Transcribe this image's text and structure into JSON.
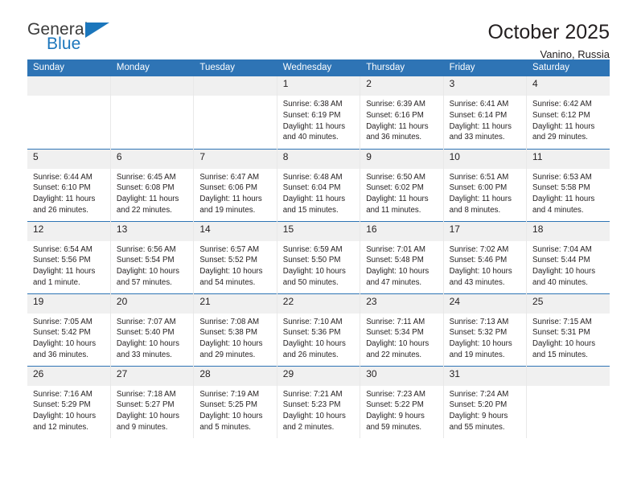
{
  "brand": {
    "name_top": "General",
    "name_bottom": "Blue",
    "accent_color": "#1b76bc"
  },
  "header": {
    "title": "October 2025",
    "location": "Vanino, Russia"
  },
  "theme": {
    "header_row_bg": "#2e74b5",
    "day_band_bg": "#f0f0f0",
    "text_color": "#231f20"
  },
  "weekday_headers": [
    "Sunday",
    "Monday",
    "Tuesday",
    "Wednesday",
    "Thursday",
    "Friday",
    "Saturday"
  ],
  "weeks": [
    [
      {
        "day": "",
        "lines": []
      },
      {
        "day": "",
        "lines": []
      },
      {
        "day": "",
        "lines": []
      },
      {
        "day": "1",
        "lines": [
          "Sunrise: 6:38 AM",
          "Sunset: 6:19 PM",
          "Daylight: 11 hours",
          "and 40 minutes."
        ]
      },
      {
        "day": "2",
        "lines": [
          "Sunrise: 6:39 AM",
          "Sunset: 6:16 PM",
          "Daylight: 11 hours",
          "and 36 minutes."
        ]
      },
      {
        "day": "3",
        "lines": [
          "Sunrise: 6:41 AM",
          "Sunset: 6:14 PM",
          "Daylight: 11 hours",
          "and 33 minutes."
        ]
      },
      {
        "day": "4",
        "lines": [
          "Sunrise: 6:42 AM",
          "Sunset: 6:12 PM",
          "Daylight: 11 hours",
          "and 29 minutes."
        ]
      }
    ],
    [
      {
        "day": "5",
        "lines": [
          "Sunrise: 6:44 AM",
          "Sunset: 6:10 PM",
          "Daylight: 11 hours",
          "and 26 minutes."
        ]
      },
      {
        "day": "6",
        "lines": [
          "Sunrise: 6:45 AM",
          "Sunset: 6:08 PM",
          "Daylight: 11 hours",
          "and 22 minutes."
        ]
      },
      {
        "day": "7",
        "lines": [
          "Sunrise: 6:47 AM",
          "Sunset: 6:06 PM",
          "Daylight: 11 hours",
          "and 19 minutes."
        ]
      },
      {
        "day": "8",
        "lines": [
          "Sunrise: 6:48 AM",
          "Sunset: 6:04 PM",
          "Daylight: 11 hours",
          "and 15 minutes."
        ]
      },
      {
        "day": "9",
        "lines": [
          "Sunrise: 6:50 AM",
          "Sunset: 6:02 PM",
          "Daylight: 11 hours",
          "and 11 minutes."
        ]
      },
      {
        "day": "10",
        "lines": [
          "Sunrise: 6:51 AM",
          "Sunset: 6:00 PM",
          "Daylight: 11 hours",
          "and 8 minutes."
        ]
      },
      {
        "day": "11",
        "lines": [
          "Sunrise: 6:53 AM",
          "Sunset: 5:58 PM",
          "Daylight: 11 hours",
          "and 4 minutes."
        ]
      }
    ],
    [
      {
        "day": "12",
        "lines": [
          "Sunrise: 6:54 AM",
          "Sunset: 5:56 PM",
          "Daylight: 11 hours",
          "and 1 minute."
        ]
      },
      {
        "day": "13",
        "lines": [
          "Sunrise: 6:56 AM",
          "Sunset: 5:54 PM",
          "Daylight: 10 hours",
          "and 57 minutes."
        ]
      },
      {
        "day": "14",
        "lines": [
          "Sunrise: 6:57 AM",
          "Sunset: 5:52 PM",
          "Daylight: 10 hours",
          "and 54 minutes."
        ]
      },
      {
        "day": "15",
        "lines": [
          "Sunrise: 6:59 AM",
          "Sunset: 5:50 PM",
          "Daylight: 10 hours",
          "and 50 minutes."
        ]
      },
      {
        "day": "16",
        "lines": [
          "Sunrise: 7:01 AM",
          "Sunset: 5:48 PM",
          "Daylight: 10 hours",
          "and 47 minutes."
        ]
      },
      {
        "day": "17",
        "lines": [
          "Sunrise: 7:02 AM",
          "Sunset: 5:46 PM",
          "Daylight: 10 hours",
          "and 43 minutes."
        ]
      },
      {
        "day": "18",
        "lines": [
          "Sunrise: 7:04 AM",
          "Sunset: 5:44 PM",
          "Daylight: 10 hours",
          "and 40 minutes."
        ]
      }
    ],
    [
      {
        "day": "19",
        "lines": [
          "Sunrise: 7:05 AM",
          "Sunset: 5:42 PM",
          "Daylight: 10 hours",
          "and 36 minutes."
        ]
      },
      {
        "day": "20",
        "lines": [
          "Sunrise: 7:07 AM",
          "Sunset: 5:40 PM",
          "Daylight: 10 hours",
          "and 33 minutes."
        ]
      },
      {
        "day": "21",
        "lines": [
          "Sunrise: 7:08 AM",
          "Sunset: 5:38 PM",
          "Daylight: 10 hours",
          "and 29 minutes."
        ]
      },
      {
        "day": "22",
        "lines": [
          "Sunrise: 7:10 AM",
          "Sunset: 5:36 PM",
          "Daylight: 10 hours",
          "and 26 minutes."
        ]
      },
      {
        "day": "23",
        "lines": [
          "Sunrise: 7:11 AM",
          "Sunset: 5:34 PM",
          "Daylight: 10 hours",
          "and 22 minutes."
        ]
      },
      {
        "day": "24",
        "lines": [
          "Sunrise: 7:13 AM",
          "Sunset: 5:32 PM",
          "Daylight: 10 hours",
          "and 19 minutes."
        ]
      },
      {
        "day": "25",
        "lines": [
          "Sunrise: 7:15 AM",
          "Sunset: 5:31 PM",
          "Daylight: 10 hours",
          "and 15 minutes."
        ]
      }
    ],
    [
      {
        "day": "26",
        "lines": [
          "Sunrise: 7:16 AM",
          "Sunset: 5:29 PM",
          "Daylight: 10 hours",
          "and 12 minutes."
        ]
      },
      {
        "day": "27",
        "lines": [
          "Sunrise: 7:18 AM",
          "Sunset: 5:27 PM",
          "Daylight: 10 hours",
          "and 9 minutes."
        ]
      },
      {
        "day": "28",
        "lines": [
          "Sunrise: 7:19 AM",
          "Sunset: 5:25 PM",
          "Daylight: 10 hours",
          "and 5 minutes."
        ]
      },
      {
        "day": "29",
        "lines": [
          "Sunrise: 7:21 AM",
          "Sunset: 5:23 PM",
          "Daylight: 10 hours",
          "and 2 minutes."
        ]
      },
      {
        "day": "30",
        "lines": [
          "Sunrise: 7:23 AM",
          "Sunset: 5:22 PM",
          "Daylight: 9 hours",
          "and 59 minutes."
        ]
      },
      {
        "day": "31",
        "lines": [
          "Sunrise: 7:24 AM",
          "Sunset: 5:20 PM",
          "Daylight: 9 hours",
          "and 55 minutes."
        ]
      },
      {
        "day": "",
        "lines": []
      }
    ]
  ]
}
